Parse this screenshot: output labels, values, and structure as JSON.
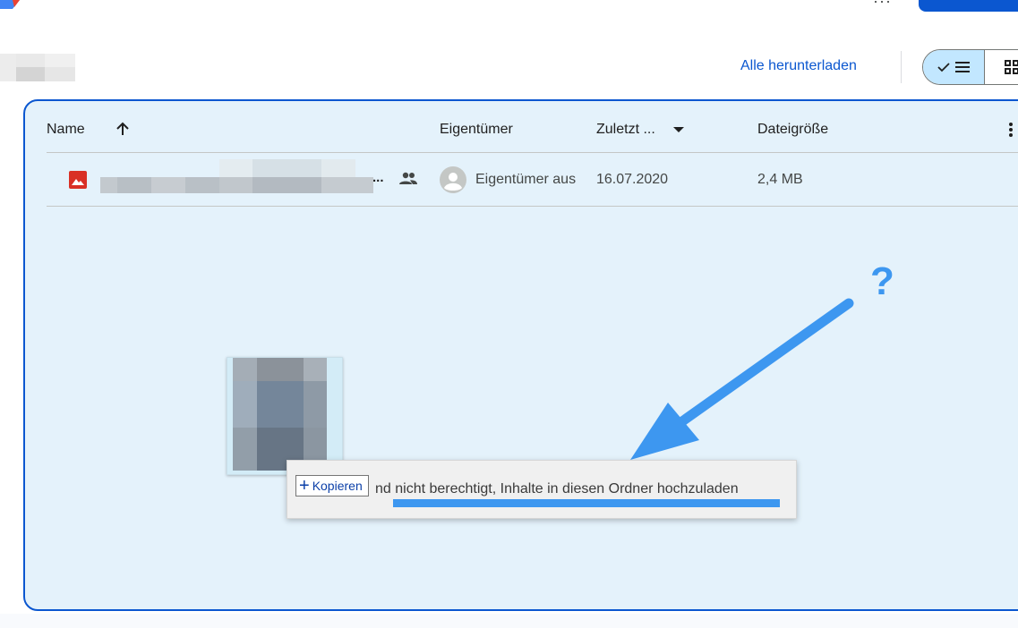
{
  "toolbar": {
    "download_all_label": "Alle herunterladen",
    "more_dots": "···"
  },
  "table": {
    "headers": {
      "name": "Name",
      "owner": "Eigentümer",
      "modified": "Zuletzt ...",
      "size": "Dateigröße"
    },
    "rows": [
      {
        "name_ellipsis": "...",
        "owner": "Eigentümer aus",
        "modified": "16.07.2020",
        "size": "2,4 MB"
      }
    ]
  },
  "drag": {
    "tooltip_text": "nd nicht berechtigt, Inhalte in diesen Ordner hochzuladen",
    "copy_plus": "+",
    "copy_label": "Kopieren"
  },
  "annotation": {
    "question_mark": "?",
    "color": "#3d97f0"
  },
  "colors": {
    "accent": "#0b57d0",
    "drop_zone_bg": "#e4f2fb",
    "file_icon_red": "#d93025",
    "selected_toggle": "#c2e7ff"
  },
  "icons": {
    "sort": "arrow-up-icon",
    "modified_sort": "caret-down-icon",
    "file_type": "image-file-icon",
    "shared": "people-icon",
    "owner_avatar": "account-circle-icon",
    "list_view": "check-list-icon",
    "grid_view": "grid-icon",
    "menu": "vertical-dots-icon"
  }
}
